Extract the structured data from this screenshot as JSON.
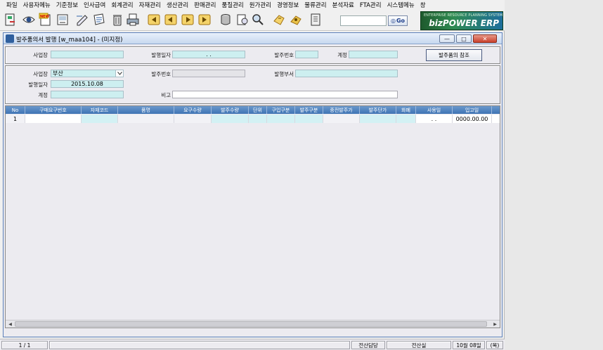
{
  "menu": [
    "파일",
    "사용자메뉴",
    "기준정보",
    "인사급여",
    "회계관리",
    "자재관리",
    "생산관리",
    "판매관리",
    "품질관리",
    "원가관리",
    "경영정보",
    "물류관리",
    "분석자료",
    "FTA관리",
    "시스템메뉴",
    "창"
  ],
  "toolbar": {
    "search_value": "",
    "go_label": "Go",
    "brand_sub": "ENTERPRISE RESOURCE PLANNING SYSTEM",
    "brand_main": "bizPOWER ERP"
  },
  "window": {
    "title": "발주품의서 발행 [w_maa104] - (미지정)",
    "close_glyph": "✕",
    "min_glyph": "—",
    "max_glyph": "□"
  },
  "panel1": {
    "site_label": "사업장",
    "site_value": "",
    "issue_date_label": "발행일자",
    "issue_date_value": ". .",
    "order_no_label": "발주번호",
    "order_no_value": "",
    "account_label": "계정",
    "account_value": "",
    "ref_button": "발주품의 참조"
  },
  "panel2": {
    "site_label": "사업장",
    "site_value": "부산",
    "order_no_label": "발주번호",
    "order_no_value": "",
    "dept_label": "발행부서",
    "dept_value": "",
    "issue_date_label": "발행일자",
    "issue_date_value": "2015.10.08",
    "account_label": "계정",
    "account_value": "",
    "remark_label": "비고",
    "remark_value": ""
  },
  "grid": {
    "columns": [
      "No",
      "구매요구번호",
      "자재코드",
      "품명",
      "요구수량",
      "발주수량",
      "단위",
      "구입구분",
      "발주구분",
      "종전발주가",
      "발주단가",
      "화폐",
      "사용일",
      "입고일"
    ],
    "rows": [
      [
        "1",
        "",
        "",
        "",
        "",
        "",
        "",
        "",
        "",
        "",
        "",
        "",
        ". .",
        "0000.00.00"
      ]
    ]
  },
  "status": {
    "page": "1 / 1",
    "message": "",
    "role": "전산담당",
    "dept": "전산실",
    "date": "10월 08일",
    "weekday": "(목)"
  }
}
